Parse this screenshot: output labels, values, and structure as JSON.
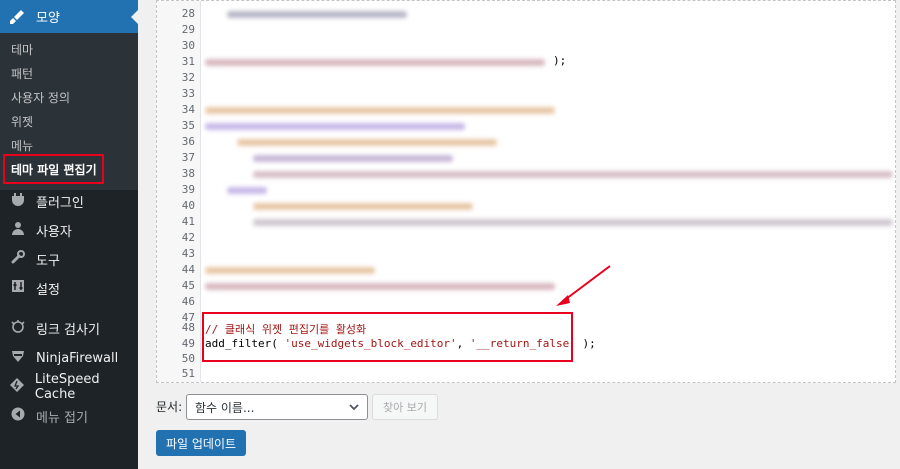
{
  "sidebar": {
    "top_item": {
      "label": "모양",
      "icon": "paintbrush-icon"
    },
    "submenu": [
      {
        "label": "테마",
        "current": false
      },
      {
        "label": "패턴",
        "current": false
      },
      {
        "label": "사용자 정의",
        "current": false
      },
      {
        "label": "위젯",
        "current": false
      },
      {
        "label": "메뉴",
        "current": false
      },
      {
        "label": "테마 파일 편집기",
        "current": true
      }
    ],
    "items": [
      {
        "label": "플러그인",
        "icon": "plugin-icon"
      },
      {
        "label": "사용자",
        "icon": "user-icon"
      },
      {
        "label": "도구",
        "icon": "wrench-icon"
      },
      {
        "label": "설정",
        "icon": "settings-icon"
      },
      {
        "label": "링크 검사기",
        "icon": "link-checker-icon"
      },
      {
        "label": "NinjaFirewall",
        "icon": "ninja-icon"
      },
      {
        "label": "LiteSpeed Cache",
        "icon": "litespeed-icon"
      },
      {
        "label": "메뉴 접기",
        "icon": "collapse-icon"
      }
    ]
  },
  "editor": {
    "line_numbers": [
      "28",
      "29",
      "30",
      "31",
      "32",
      "33",
      "34",
      "35",
      "36",
      "37",
      "38",
      "39",
      "40",
      "41",
      "42",
      "43",
      "44",
      "45",
      "46",
      "47",
      "48",
      "49",
      "50",
      "51"
    ],
    "line31_tail": ");",
    "line48_comment": "// 클래식 위젯 편집기를 활성화",
    "line49": {
      "fn": "add_filter( ",
      "arg1": "'use_widgets_block_editor'",
      "sep": ", ",
      "arg2": "'__return_false'",
      "end": " );"
    }
  },
  "footer": {
    "doc_label": "문서:",
    "select_value": "함수 이름...",
    "view_button": "찾아 보기",
    "update_button": "파일 업데이트"
  },
  "colors": {
    "accent": "#2271b1",
    "annotation": "#e8001c",
    "sidebar_bg": "#1d2327"
  }
}
